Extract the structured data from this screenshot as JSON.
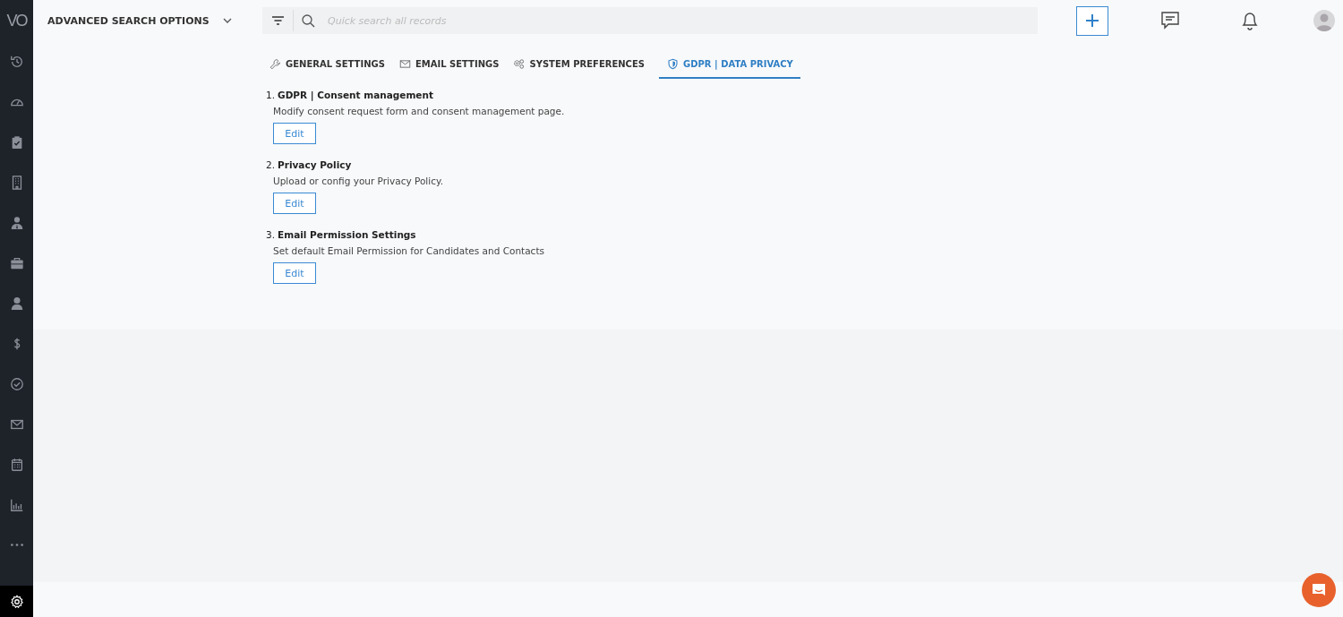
{
  "logo": "VO",
  "sidebar": {
    "items": [
      {
        "selected": false
      },
      {
        "selected": false
      },
      {
        "selected": false
      },
      {
        "selected": false
      },
      {
        "selected": false
      },
      {
        "selected": false
      },
      {
        "selected": false
      },
      {
        "selected": false
      },
      {
        "selected": false
      },
      {
        "selected": false
      },
      {
        "selected": false
      },
      {
        "selected": false
      },
      {
        "selected": false
      }
    ],
    "settings": {
      "selected": true
    }
  },
  "header": {
    "advanced_search": "ADVANCED SEARCH OPTIONS",
    "search": {
      "placeholder": "Quick search all records"
    }
  },
  "tabs": [
    {
      "label": "GENERAL SETTINGS",
      "selected": false
    },
    {
      "label": "EMAIL SETTINGS",
      "selected": false
    },
    {
      "label": "SYSTEM PREFERENCES",
      "selected": false
    },
    {
      "label": "GDPR | DATA PRIVACY",
      "selected": true
    }
  ],
  "sections": [
    {
      "number": "1.",
      "title": "GDPR | Consent management",
      "description": "Modify consent request form and consent management page.",
      "button": "Edit"
    },
    {
      "number": "2.",
      "title": "Privacy Policy",
      "description": "Upload or config your Privacy Policy.",
      "button": "Edit"
    },
    {
      "number": "3.",
      "title": "Email Permission Settings",
      "description": "Set default Email Permission for Candidates and Contacts",
      "button": "Edit"
    }
  ]
}
